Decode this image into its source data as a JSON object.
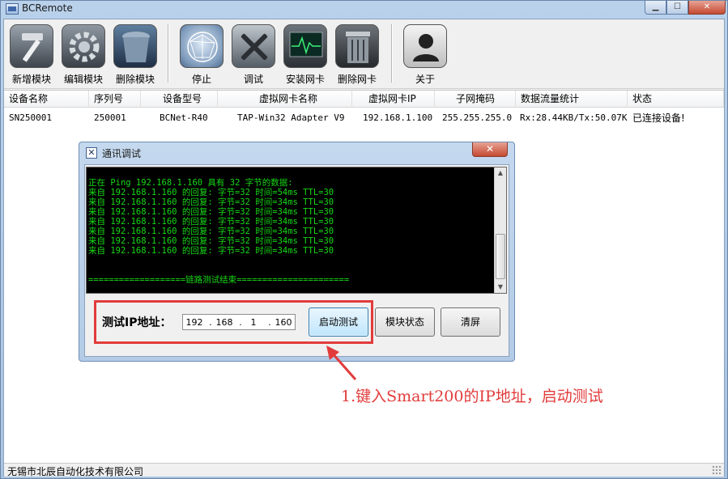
{
  "window": {
    "title": "BCRemote"
  },
  "toolbar": [
    {
      "label": "新增模块",
      "icon": "hammer-icon"
    },
    {
      "label": "编辑模块",
      "icon": "gear-icon"
    },
    {
      "label": "删除模块",
      "icon": "trash-icon"
    },
    {
      "label": "停止",
      "icon": "network-globe-icon"
    },
    {
      "label": "调试",
      "icon": "tools-icon"
    },
    {
      "label": "安装网卡",
      "icon": "monitor-pulse-icon"
    },
    {
      "label": "删除网卡",
      "icon": "trash-can-icon"
    },
    {
      "label": "关于",
      "icon": "user-icon"
    }
  ],
  "table": {
    "headers": [
      "设备名称",
      "序列号",
      "设备型号",
      "虚拟网卡名称",
      "虚拟网卡IP",
      "子网掩码",
      "数据流量统计",
      "状态"
    ],
    "rows": [
      [
        "SN250001",
        "250001",
        "BCNet-R40",
        "TAP-Win32 Adapter V9",
        "192.168.1.100",
        "255.255.255.0",
        "Rx:28.44KB/Tx:50.07KB",
        "已连接设备!"
      ]
    ]
  },
  "dialog": {
    "title": "通讯调试",
    "console_lines": [
      "正在 Ping 192.168.1.160 具有 32 字节的数据:",
      "来自 192.168.1.160 的回复: 字节=32 时间=54ms TTL=30",
      "来自 192.168.1.160 的回复: 字节=32 时间=34ms TTL=30",
      "来自 192.168.1.160 的回复: 字节=32 时间=34ms TTL=30",
      "来自 192.168.1.160 的回复: 字节=32 时间=34ms TTL=30",
      "来自 192.168.1.160 的回复: 字节=32 时间=34ms TTL=30",
      "来自 192.168.1.160 的回复: 字节=32 时间=34ms TTL=30",
      "来自 192.168.1.160 的回复: 字节=32 时间=34ms TTL=30",
      "",
      "",
      "===================链路测试结束======================"
    ],
    "ip_label": "测试IP地址：",
    "ip": [
      "192",
      "168",
      "1",
      "160"
    ],
    "buttons": {
      "start": "启动测试",
      "module_status": "模块状态",
      "clear": "清屏"
    }
  },
  "annotation": {
    "text": "1.键入Smart200的IP地址，启动测试",
    "color": "#e23b3b"
  },
  "statusbar": {
    "text": "无锡市北辰自动化技术有限公司"
  }
}
